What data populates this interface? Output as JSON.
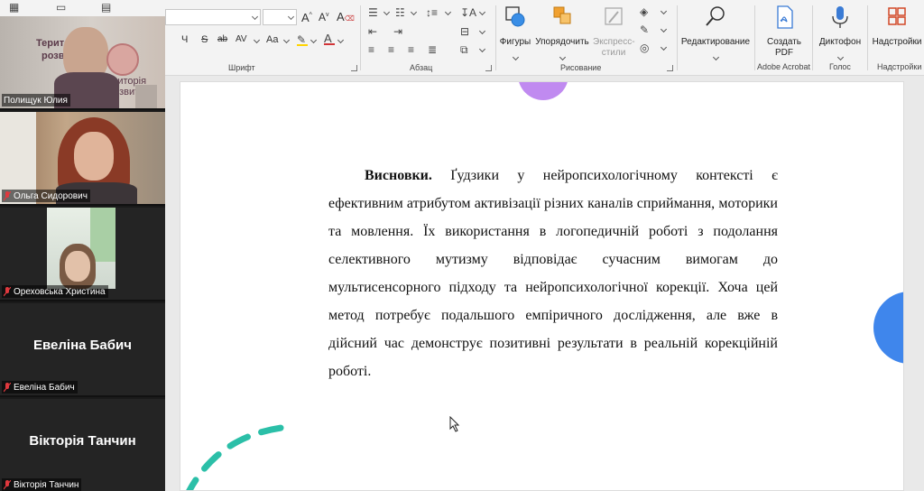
{
  "ribbon": {
    "font_group_label": "Шрифт",
    "paragraph_group_label": "Абзац",
    "drawing_group_label": "Рисование",
    "adobe_group_label": "Adobe Acrobat",
    "voice_group_label": "Голос",
    "addins_group_label": "Надстройки",
    "shapes_label": "Фигуры",
    "arrange_label": "Упорядочить",
    "quick_styles_line1": "Экспресс-",
    "quick_styles_line2": "стили",
    "editing_label": "Редактирование",
    "create_pdf_line1": "Создать",
    "create_pdf_line2": "PDF",
    "dictate_label": "Диктофон",
    "addins_label": "Надстройки",
    "font_buttons": [
      "Ч",
      "S",
      "ab",
      "AV",
      "Aa"
    ]
  },
  "document": {
    "paragraph_bold": "Висновки.",
    "paragraph_text": " Ґудзики у нейропсихологічному контексті є ефективним  атрибутом активізації різних каналів сприймання, моторики та мовлення. Їх використання в логопедичній роботі з подолання селективного мутизму відповідає сучасним вимогам до мультисенсорного підходу та нейропсихологічної корекції. Хоча цей метод потребує подальшого емпіричного дослідження, але вже в дійсний час демонструє позитивні результати в реальній корекційній роботі."
  },
  "participants": [
    {
      "name": "Полищук Юлия",
      "video_caption_line1": "Територія",
      "video_caption_line2": "розвитку",
      "video_caption_partial1": "Терито",
      "video_caption_partial2": "розв"
    },
    {
      "name": "Ольга Сидорович"
    },
    {
      "name": "Ореховська Христина"
    },
    {
      "name": "Евеліна Бабич",
      "display_name": "Евеліна Бабич"
    },
    {
      "name": "Вікторія Танчин",
      "display_name": "Вікторія Танчин"
    }
  ],
  "colors": {
    "purple_shape": "#c08af0",
    "blue_shape": "#3f86ec",
    "teal_arc": "#2bbfa8",
    "mic_muted": "#e0393e"
  }
}
